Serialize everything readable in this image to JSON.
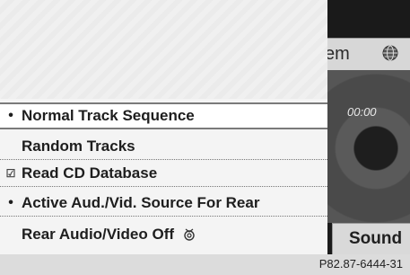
{
  "header": {
    "tab_label": "em",
    "globe_icon": "globe-icon"
  },
  "display": {
    "time": "00:00",
    "sound_label": "Sound"
  },
  "menu": {
    "items": [
      {
        "label": "Normal Track Sequence",
        "marker": "•",
        "selected": true
      },
      {
        "label": "Random Tracks",
        "marker": ""
      },
      {
        "label": "Read CD Database",
        "marker": "☑"
      },
      {
        "label": "Active Aud./Vid. Source For Rear",
        "marker": "•"
      },
      {
        "label": "Rear Audio/Video Off",
        "marker": "",
        "icon": "mute-icon"
      }
    ]
  },
  "footer": {
    "code": "P82.87-6444-31"
  }
}
